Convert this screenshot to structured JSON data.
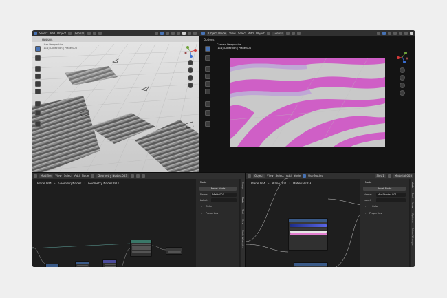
{
  "left_viewport": {
    "header": {
      "menus": [
        "Select",
        "Add",
        "Object"
      ],
      "orientation": "Global",
      "options": "Options"
    },
    "overlay_lines": [
      "User Perspective",
      "(114) Collection | Plane.003"
    ]
  },
  "right_viewport": {
    "header": {
      "mode": "Object Mode",
      "menus": [
        "View",
        "Select",
        "Add",
        "Object"
      ],
      "orientation": "Global",
      "options": "Options"
    },
    "overlay_lines": [
      "Camera Perspective",
      "(114) Collection | Plane.004"
    ]
  },
  "geo_editor": {
    "header": {
      "mode": "Modifier",
      "menus": [
        "View",
        "Select",
        "Add",
        "Node"
      ],
      "node_tree": "Geometry Nodes.003"
    },
    "breadcrumb": [
      "Plane.004",
      "GeometryNodes",
      "Geometry Nodes.003"
    ],
    "nodes": [
      "Set Position",
      "Math",
      "Math",
      "Multiply",
      "Group Output"
    ]
  },
  "geo_sidebar": {
    "section": "Node",
    "reset": "Reset Node",
    "name_label": "Name:",
    "name_value": "Math.001",
    "label_label": "Label:",
    "label_value": "",
    "color": "Color",
    "properties": "Properties",
    "tabs": [
      "Group",
      "Node",
      "Tool",
      "View",
      "Node Wrangler"
    ]
  },
  "shader_editor": {
    "header": {
      "mode": "Object",
      "menus": [
        "View",
        "Select",
        "Add",
        "Node"
      ],
      "use_nodes": "Use Nodes",
      "slot": "Slot 1",
      "material": "Material.003"
    },
    "breadcrumb": [
      "Plane.004",
      "Plane.002",
      "Material.003"
    ],
    "nodes": [
      "Color Ramp",
      "Color Ramp",
      "Mix Shader",
      "Material Output"
    ]
  },
  "shader_sidebar": {
    "section": "Node",
    "reset": "Reset Node",
    "name_label": "Name:",
    "name_value": "Mix Shader.001",
    "label_label": "Label:",
    "label_value": "",
    "color": "Color",
    "properties": "Properties",
    "tabs": [
      "Node",
      "Tool",
      "View",
      "Options",
      "Node Wrangler"
    ]
  }
}
